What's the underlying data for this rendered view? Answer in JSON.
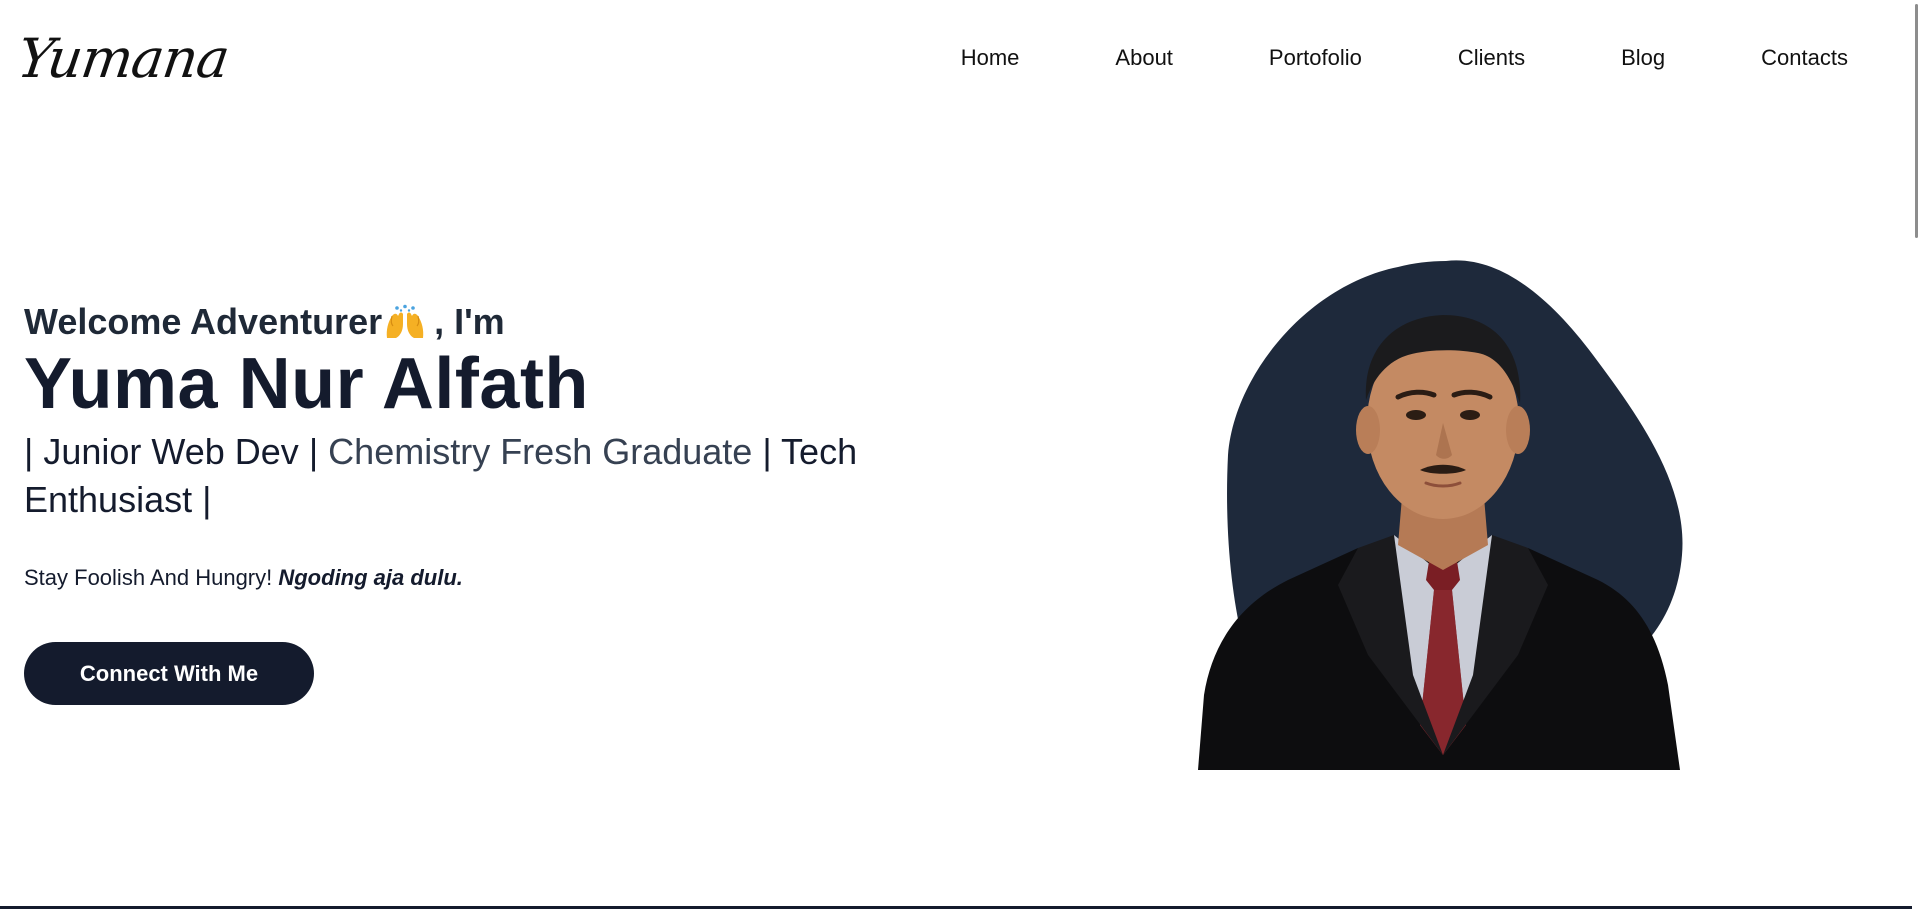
{
  "header": {
    "logo_text": "Yumana",
    "nav": [
      {
        "label": "Home"
      },
      {
        "label": "About"
      },
      {
        "label": "Portofolio"
      },
      {
        "label": "Clients"
      },
      {
        "label": "Blog"
      },
      {
        "label": "Contacts"
      }
    ]
  },
  "hero": {
    "greeting_prefix": "Welcome Adventurer",
    "greeting_suffix": ", I'm",
    "greeting_icon": "raised-hands-icon",
    "name": "Yuma Nur Alfath",
    "roles": {
      "sep1": "| ",
      "role1": "Junior Web Dev",
      "sep2": " | ",
      "role2": "Chemistry Fresh Graduate",
      "sep3": " | ",
      "role3": "Tech Enthusiast",
      "sep4": " |"
    },
    "tagline_plain": "Stay Foolish And Hungry! ",
    "tagline_emphasis": "Ngoding aja dulu.",
    "cta_label": "Connect With Me"
  },
  "colors": {
    "primary": "#141b2d",
    "blob": "#1e293b",
    "accent_text": "#364152",
    "background": "#ffffff"
  }
}
